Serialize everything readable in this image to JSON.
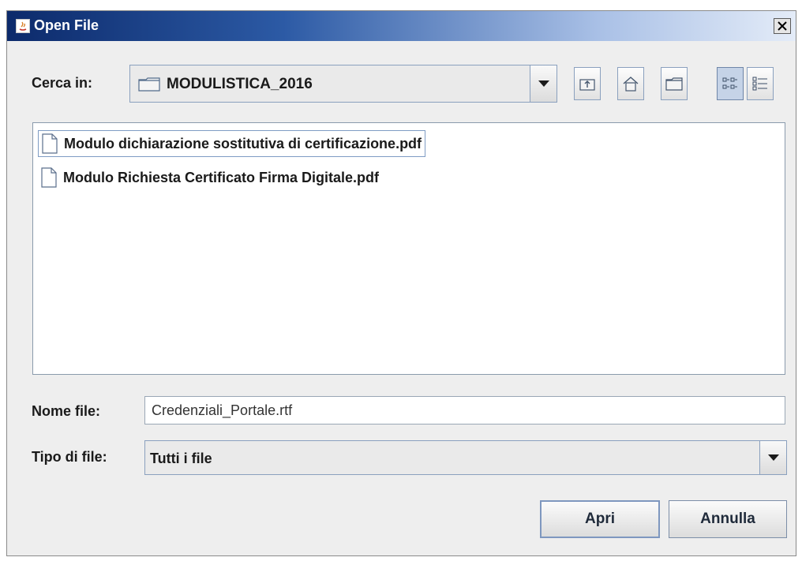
{
  "window": {
    "title": "Open File"
  },
  "look_in": {
    "label": "Cerca in:",
    "value": "MODULISTICA_2016"
  },
  "toolbar": {
    "icons": [
      "up-one-level-icon",
      "home-icon",
      "new-folder-icon",
      "list-view-icon",
      "details-view-icon"
    ],
    "selected_view": "list"
  },
  "files": [
    {
      "name": "Modulo dichiarazione sostitutiva di certificazione.pdf",
      "selected": true
    },
    {
      "name": "Modulo Richiesta Certificato Firma Digitale.pdf",
      "selected": false
    }
  ],
  "file_name": {
    "label": "Nome file:",
    "value": "Credenziali_Portale.rtf"
  },
  "file_type": {
    "label": "Tipo di file:",
    "value": "Tutti i file"
  },
  "buttons": {
    "open": "Apri",
    "cancel": "Annulla"
  },
  "colors": {
    "title_gradient_start": "#0c2a6b",
    "title_gradient_end": "#e4ecf8",
    "selection_border": "#7f9cc4"
  }
}
